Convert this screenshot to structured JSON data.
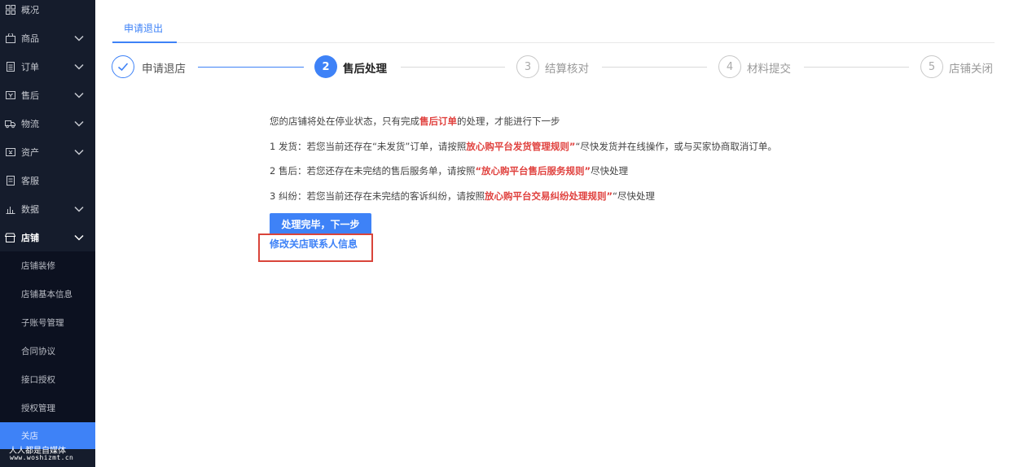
{
  "sidebar": {
    "items": [
      {
        "label": "概况",
        "icon": "grid-icon",
        "chevron": false
      },
      {
        "label": "商品",
        "icon": "bag-icon",
        "chevron": true
      },
      {
        "label": "订单",
        "icon": "document-icon",
        "chevron": true
      },
      {
        "label": "售后",
        "icon": "return-icon",
        "chevron": true
      },
      {
        "label": "物流",
        "icon": "truck-icon",
        "chevron": true
      },
      {
        "label": "资产",
        "icon": "wallet-icon",
        "chevron": true
      },
      {
        "label": "客服",
        "icon": "headset-icon",
        "chevron": false
      },
      {
        "label": "数据",
        "icon": "bar-chart-icon",
        "chevron": true
      },
      {
        "label": "店铺",
        "icon": "shop-icon",
        "chevron": true
      }
    ],
    "shop_sub_items": [
      "店铺装修",
      "店铺基本信息",
      "子账号管理",
      "合同协议",
      "接口授权",
      "授权管理",
      "关店"
    ]
  },
  "watermark": {
    "line1": "人人都是自媒体",
    "line2": "www.woshizmt.cn"
  },
  "tab": {
    "label": "申请退出"
  },
  "steps": [
    {
      "number": "",
      "label": "申请退店",
      "state": "done"
    },
    {
      "number": "2",
      "label": "售后处理",
      "state": "current"
    },
    {
      "number": "3",
      "label": "结算核对",
      "state": "todo"
    },
    {
      "number": "4",
      "label": "材料提交",
      "state": "todo"
    },
    {
      "number": "5",
      "label": "店铺关闭",
      "state": "todo"
    }
  ],
  "notice": {
    "intro_before": "您的店铺将处在停业状态，只有完成",
    "intro_highlight": "售后订单",
    "intro_after": "的处理，才能进行下一步",
    "line1_before": "1 发货：若您当前还存在“未发货”订单，请按照",
    "line1_highlight": "放心购平台发货管理规则”",
    "line1_after": "“尽快发货并在线操作，或与买家协商取消订单。",
    "line2_before": "2 售后：若您还存在未完结的售后服务单，请按照",
    "line2_highlight": "“放心购平台售后服务规则”",
    "line2_after": "尽快处理",
    "line3_before": "3 纠纷：若您当前还存在未完结的客诉纠纷，请按照",
    "line3_highlight": "放心购平台交易纠纷处理规则”",
    "line3_after": "“尽快处理"
  },
  "actions": {
    "next_button": "处理完毕，下一步",
    "edit_contact_link": "修改关店联系人信息"
  },
  "colors": {
    "accent": "#3e82f7",
    "highlight": "#e0413e",
    "sidebar_bg": "#151c2c",
    "annotation_box": "#d9443a"
  }
}
